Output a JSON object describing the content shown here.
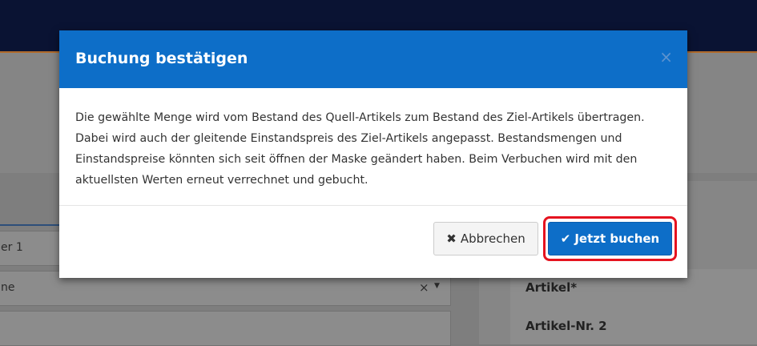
{
  "modal": {
    "title": "Buchung bestätigen",
    "close_icon": "×",
    "body_text": "Die gewählte Menge wird vom Bestand des Quell-Artikels zum Bestand des Ziel-Artikels übertragen. Dabei wird auch der gleitende Einstandspreis des Ziel-Artikels angepasst. Bestandsmengen und Einstandspreise könnten sich seit öffnen der Maske geändert haben. Beim Verbuchen wird mit den aktuellsten Werten erneut verrechnet und gebucht.",
    "cancel_icon": "✖",
    "cancel_label": "Abbrechen",
    "confirm_icon": "✔",
    "confirm_label": "Jetzt buchen"
  },
  "background": {
    "field1_text": "er 1",
    "field2_text": "ne",
    "clear_icon": "×",
    "dropdown_icon": "▼",
    "label_artikel": "Artikel*",
    "label_artikel_nr": "Artikel-Nr. 2"
  },
  "colors": {
    "header_blue": "#0d6ec8",
    "highlight_red": "#e5131f",
    "topbar": "#0a1333"
  }
}
